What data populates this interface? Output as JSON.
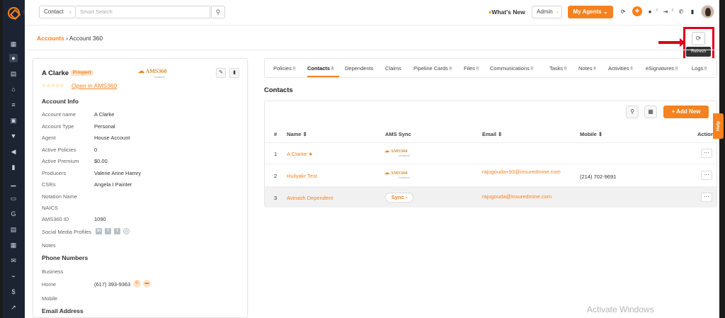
{
  "topbar": {
    "search_type": "Contact",
    "search_placeholder": "Smart Search",
    "whats_new": "What's New",
    "role": "Admin",
    "agents_button": "My Agents",
    "notif_badge_1": "0",
    "notif_badge_2": "0"
  },
  "breadcrumb": {
    "parent": "Accounts",
    "separator": " › ",
    "current": "Account 360"
  },
  "refresh": {
    "tooltip": "Refresh"
  },
  "account": {
    "name": "A Clarke",
    "status": "Prospect",
    "ams_logo": "AMS360",
    "ams_sub": "Vertafore",
    "open_link": "Open in AMS360",
    "stars": "☆☆☆☆☆",
    "info_title": "Account Info",
    "fields": [
      {
        "label": "Account name",
        "value": "A Clarke"
      },
      {
        "label": "Account Type",
        "value": "Personal"
      },
      {
        "label": "Agent",
        "value": "House Account"
      },
      {
        "label": "Active Policies",
        "value": "0"
      },
      {
        "label": "Active Premium",
        "value": "$0.00"
      },
      {
        "label": "Producers",
        "value": "Valerie Anne Hamry"
      },
      {
        "label": "CSRs",
        "value": "Angela I Painter"
      },
      {
        "label": "Notation Name",
        "value": ""
      },
      {
        "label": "NAICS",
        "value": ""
      },
      {
        "label": "AMS360 ID",
        "value": "1090"
      },
      {
        "label": "Social Media Profiles",
        "value": ""
      },
      {
        "label": "Notes",
        "value": ""
      }
    ],
    "phone_title": "Phone Numbers",
    "phones": [
      {
        "label": "Business",
        "value": ""
      },
      {
        "label": "Home",
        "value": "(617) 393-9363"
      },
      {
        "label": "Mobile",
        "value": ""
      }
    ],
    "email_title": "Email Address"
  },
  "tabs": [
    {
      "label": "Policies",
      "count": "0"
    },
    {
      "label": "Contacts",
      "count": "3"
    },
    {
      "label": "Dependents",
      "count": ""
    },
    {
      "label": "Claims",
      "count": ""
    },
    {
      "label": "Pipeline Cards",
      "count": "0"
    },
    {
      "label": "Files",
      "count": "0"
    },
    {
      "label": "Communications",
      "count": "0"
    },
    {
      "label": "Tasks",
      "count": "0"
    },
    {
      "label": "Notes",
      "count": "0"
    },
    {
      "label": "Activities",
      "count": "0"
    },
    {
      "label": "eSignatures",
      "count": "0"
    },
    {
      "label": "Logs",
      "count": "0"
    }
  ],
  "contacts": {
    "heading": "Contacts",
    "add_button": "+ Add New",
    "columns": [
      "#",
      "Name ⇕",
      "AMS Sync",
      "Email ⇕",
      "Mobile ⇕",
      "Action"
    ],
    "rows": [
      {
        "num": "1",
        "name": "A Clarke ★",
        "sync": "AMS360",
        "email": "",
        "mobile": ""
      },
      {
        "num": "2",
        "name": "Huliyakr Test",
        "sync": "AMS360",
        "email": "rajugouda+93@insuredmine.com",
        "mobile": "(214) 702-9691"
      },
      {
        "num": "3",
        "name": "Avinash Dependent",
        "sync": "Sync ›",
        "email": "rajugouda@insuredmine.com",
        "mobile": ""
      }
    ]
  },
  "help": "Help",
  "watermark": "Activate Windows",
  "colors": {
    "accent": "#f5821f",
    "sidebar": "#1c2433",
    "highlight": "#e0001b"
  }
}
